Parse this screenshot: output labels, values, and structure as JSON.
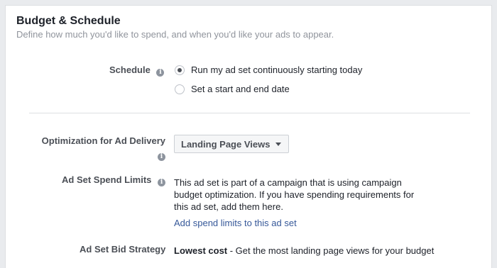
{
  "section": {
    "title": "Budget & Schedule",
    "subtitle": "Define how much you'd like to spend, and when you'd like your ads to appear."
  },
  "schedule": {
    "label": "Schedule",
    "info_icon": "info-icon",
    "options": [
      {
        "label": "Run my ad set continuously starting today",
        "selected": true
      },
      {
        "label": "Set a start and end date",
        "selected": false
      }
    ]
  },
  "optimization": {
    "label": "Optimization for Ad Delivery",
    "info_icon": "info-icon",
    "value": "Landing Page Views",
    "caret_icon": "caret-down-icon"
  },
  "spend_limits": {
    "label": "Ad Set Spend Limits",
    "info_icon": "info-icon",
    "description": "This ad set is part of a campaign that is using campaign budget optimization. If you have spending requirements for this ad set, add them here.",
    "link": "Add spend limits to this ad set"
  },
  "bid_strategy": {
    "label": "Ad Set Bid Strategy",
    "value_bold": "Lowest cost",
    "value_rest": " - Get the most landing page views for your budget"
  },
  "colors": {
    "page_bg": "#e9ebee",
    "panel_bg": "#ffffff",
    "link": "#365899",
    "muted_text": "#90949c"
  }
}
